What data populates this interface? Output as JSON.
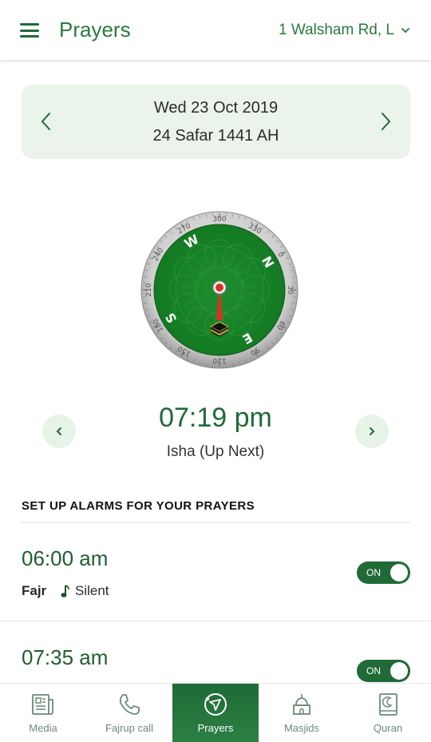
{
  "header": {
    "title": "Prayers",
    "location": "1 Walsham Rd, L"
  },
  "date": {
    "gregorian": "Wed 23 Oct 2019",
    "hijri": "24 Safar 1441 AH"
  },
  "compass": {
    "ring_labels": [
      "300",
      "330",
      "0",
      "30",
      "60",
      "90",
      "120",
      "150",
      "180",
      "210",
      "240",
      "270"
    ],
    "cardinals": [
      "N",
      "E",
      "S",
      "W"
    ],
    "face_color": "#1e8a2e"
  },
  "next_prayer": {
    "time": "07:19 pm",
    "name": "Isha (Up Next)"
  },
  "alarms": {
    "heading": "SET UP ALARMS FOR YOUR PRAYERS",
    "items": [
      {
        "time": "06:00 am",
        "name": "Fajr",
        "sound": "Silent",
        "toggle": "ON"
      },
      {
        "time": "07:35 am",
        "toggle": "ON"
      }
    ]
  },
  "bottom_nav": [
    {
      "label": "Media",
      "icon": "newspaper-icon"
    },
    {
      "label": "Fajrup call",
      "icon": "phone-icon"
    },
    {
      "label": "Prayers",
      "icon": "compass-icon",
      "active": true
    },
    {
      "label": "Masjids",
      "icon": "mosque-icon"
    },
    {
      "label": "Quran",
      "icon": "quran-icon"
    }
  ],
  "colors": {
    "primary": "#1f6a37",
    "accent_light": "#eaf4ea"
  }
}
